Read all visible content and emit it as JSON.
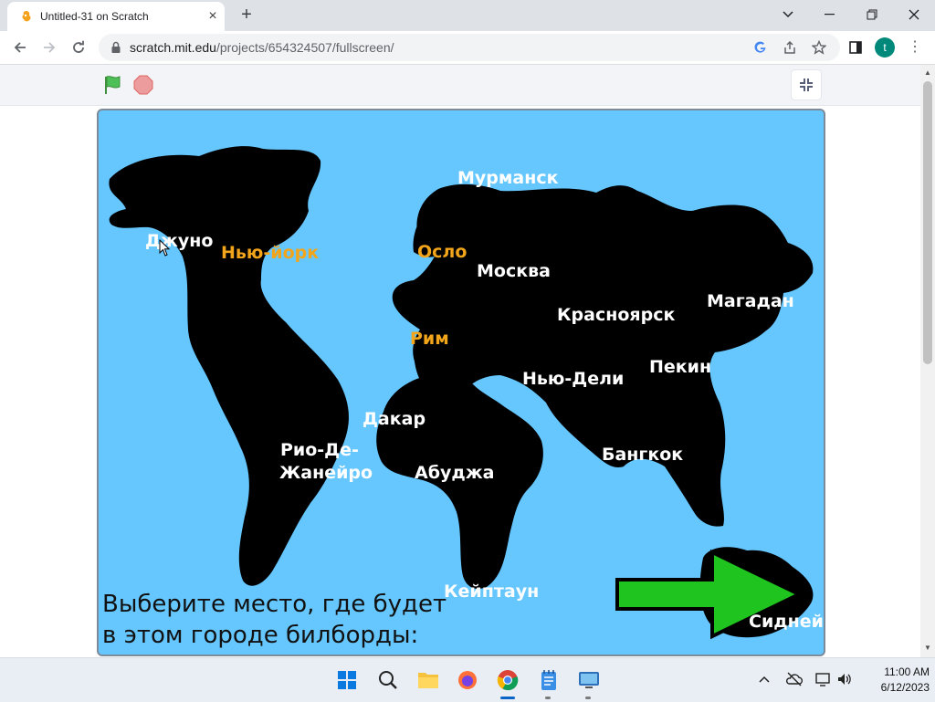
{
  "browser": {
    "tab_title": "Untitled-31 on Scratch",
    "url_domain": "scratch.mit.edu",
    "url_path": "/projects/654324507/fullscreen/",
    "profile_initial": "t"
  },
  "stage": {
    "cities": [
      {
        "name": "Мурманск",
        "color": "white"
      },
      {
        "name": "Джуно",
        "color": "white"
      },
      {
        "name": "Нью-йорк",
        "color": "orange"
      },
      {
        "name": "Осло",
        "color": "orange"
      },
      {
        "name": "Москва",
        "color": "white"
      },
      {
        "name": "Магадан",
        "color": "white"
      },
      {
        "name": "Красноярск",
        "color": "white"
      },
      {
        "name": "Рим",
        "color": "orange"
      },
      {
        "name": "Пекин",
        "color": "white"
      },
      {
        "name": "Нью-Дели",
        "color": "white"
      },
      {
        "name": "Дакар",
        "color": "white"
      },
      {
        "name": "Рио-Де-",
        "color": "white"
      },
      {
        "name": "Жанейро",
        "color": "white"
      },
      {
        "name": "Бангкок",
        "color": "white"
      },
      {
        "name": "Абуджа",
        "color": "white"
      },
      {
        "name": "Кейптаун",
        "color": "white"
      },
      {
        "name": "Сидней",
        "color": "white"
      }
    ],
    "prompt_line1": "Выберите место, где будет",
    "prompt_line2": "в этом городе билборды:",
    "colors": {
      "sea": "#66c7ff",
      "land": "#000000",
      "orange_label": "#f2a51a",
      "arrow": "#1fc41f"
    }
  },
  "taskbar": {
    "time": "11:00 AM",
    "date": "6/12/2023"
  }
}
